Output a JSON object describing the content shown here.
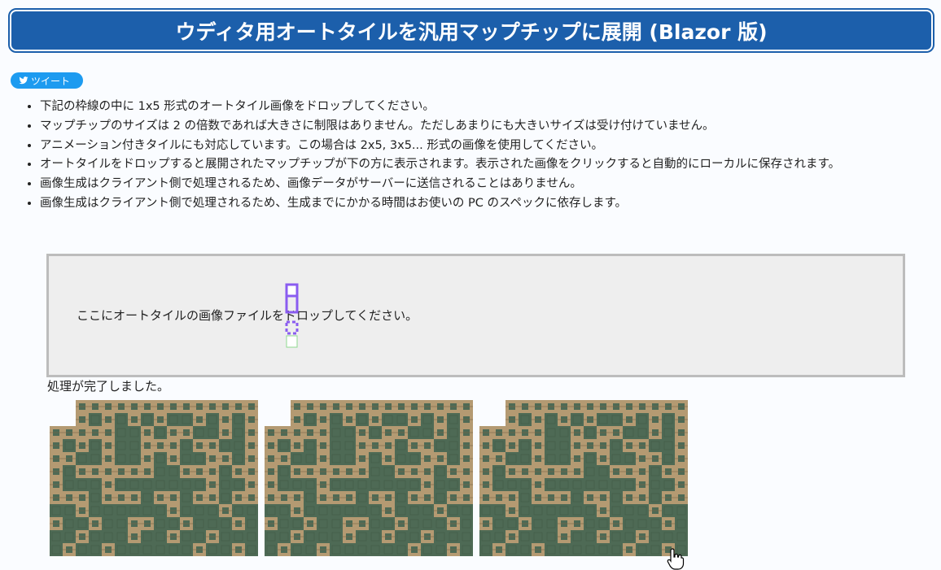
{
  "header": {
    "title": "ウディタ用オートタイルを汎用マップチップに展開 (Blazor 版)"
  },
  "tweet": {
    "label": "ツイート",
    "icon": "twitter-bird-icon",
    "color": "#1d9bf0"
  },
  "notes": [
    "下記の枠線の中に 1x5 形式のオートタイル画像をドロップしてください。",
    "マップチップのサイズは 2 の倍数であれば大きさに制限はありません。ただしあまりにも大きいサイズは受け付けていません。",
    "アニメーション付きタイルにも対応しています。この場合は 2x5, 3x5... 形式の画像を使用してください。",
    "オートタイルをドロップすると展開されたマップチップが下の方に表示されます。表示された画像をクリックすると自動的にローカルに保存されます。",
    "画像生成はクライアント側で処理されるため、画像データがサーバーに送信されることはありません。",
    "画像生成はクライアント側で処理されるため、生成までにかかる時間はお使いの PC のスペックに依存します。"
  ],
  "drop_zone": {
    "text": "ここにオートタイルの画像ファイルをドロップしてください。"
  },
  "status": {
    "text": "処理が完了しました。"
  },
  "colors": {
    "header_bg": "#1c5fab",
    "page_bg": "#fafcff",
    "drop_zone_bg": "#eeeeee",
    "drop_zone_border": "#bcbcbc",
    "tile_floor": "#4e6a55",
    "tile_wall": "#b49a72",
    "drag_marker": "#8a5cf0"
  },
  "chips": [
    {
      "name": "chip-image-1"
    },
    {
      "name": "chip-image-2"
    },
    {
      "name": "chip-image-3"
    }
  ]
}
